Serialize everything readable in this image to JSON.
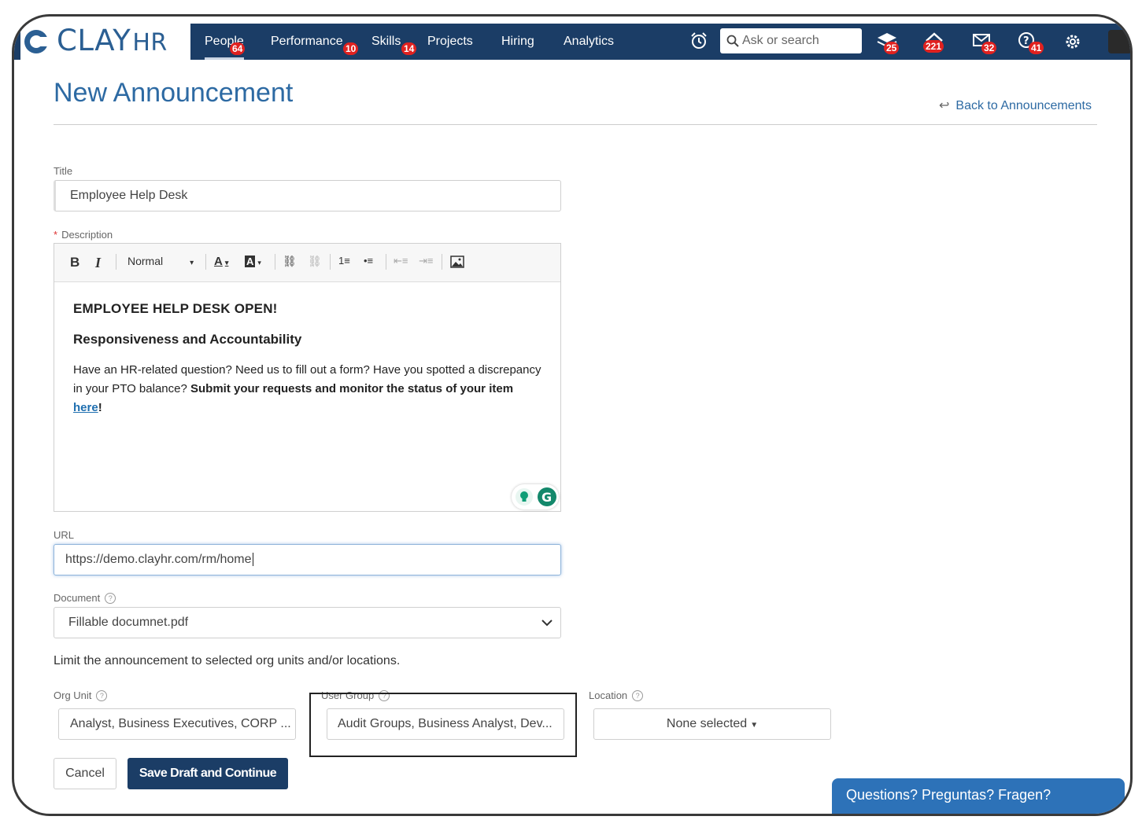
{
  "app": {
    "brand_main": "CLAY",
    "brand_suffix": "HR"
  },
  "nav": {
    "items": [
      {
        "label": "People",
        "badge": "64"
      },
      {
        "label": "Performance",
        "badge": "10"
      },
      {
        "label": "Skills",
        "badge": "14"
      },
      {
        "label": "Projects",
        "badge": ""
      },
      {
        "label": "Hiring",
        "badge": ""
      },
      {
        "label": "Analytics",
        "badge": ""
      }
    ],
    "search_placeholder": "Ask or search",
    "icon_badges": {
      "learning": "25",
      "inbox": "221",
      "messages": "32",
      "help": "41"
    }
  },
  "page": {
    "title": "New Announcement",
    "back_link": "Back to Announcements"
  },
  "form": {
    "title_label": "Title",
    "title_value": "Employee Help Desk",
    "description_label": "Description",
    "toolbar": {
      "bold": "B",
      "italic": "I",
      "format": "Normal"
    },
    "editor": {
      "heading1": "EMPLOYEE HELP DESK OPEN!",
      "heading2": "Responsiveness and Accountability",
      "para_plain": "Have an HR-related question? Need us to fill out a form? Have you spotted a discrepancy in your PTO balance?",
      "para_bold": "Submit your requests and monitor the status of your item",
      "link_text": "here",
      "para_end": "!"
    },
    "url_label": "URL",
    "url_value": "https://demo.clayhr.com/rm/home",
    "document_label": "Document",
    "document_value": "Fillable documnet.pdf",
    "limit_text": "Limit the announcement to selected org units and/or locations.",
    "org_unit_label": "Org Unit",
    "org_unit_value": "Analyst, Business Executives, CORP ...",
    "user_group_label": "User Group",
    "user_group_value": "Audit Groups, Business Analyst, Dev...",
    "location_label": "Location",
    "location_value": "None selected"
  },
  "buttons": {
    "cancel": "Cancel",
    "save": "Save Draft and Continue"
  },
  "chat": {
    "label": "Questions? Preguntas? Fragen?"
  },
  "colors": {
    "nav_bg": "#1b3d66",
    "accent": "#2d6aa3",
    "badge": "#e0211f",
    "chat_bg": "#2d72b8"
  }
}
